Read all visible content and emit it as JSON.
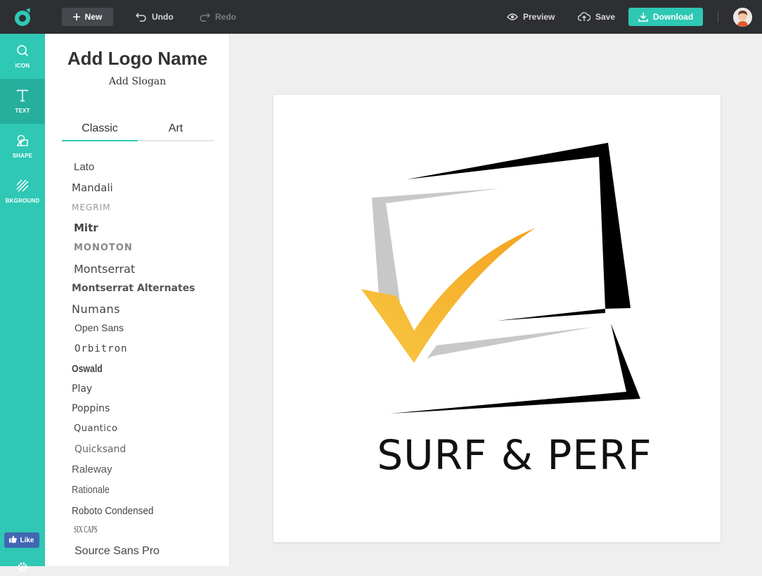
{
  "toolbar": {
    "new_label": "New",
    "undo_label": "Undo",
    "redo_label": "Redo",
    "preview_label": "Preview",
    "save_label": "Save",
    "download_label": "Download"
  },
  "rail": {
    "items": [
      {
        "label": "ICON",
        "icon": "search-icon"
      },
      {
        "label": "TEXT",
        "icon": "text-icon"
      },
      {
        "label": "SHAPE",
        "icon": "shape-icon"
      },
      {
        "label": "BKGROUND",
        "icon": "background-icon"
      }
    ],
    "like_label": "Like"
  },
  "panel": {
    "logo_name": "Add Logo Name",
    "slogan": "Add Slogan",
    "tabs": [
      "Classic",
      "Art"
    ],
    "fonts": [
      "Lato",
      "Mandali",
      "MEGRIM",
      "Mitr",
      "MONOTON",
      "Montserrat",
      "Montserrat Alternates",
      "Numans",
      "Open Sans",
      "Orbitron",
      "Oswald",
      "Play",
      "Poppins",
      "Quantico",
      "Quicksand",
      "Raleway",
      "Rationale",
      "Roboto Condensed",
      "SIX CAPS",
      "Source Sans Pro"
    ]
  },
  "canvas": {
    "brand_text": "SURF & PERF",
    "colors": {
      "accent": "#2ec8b4",
      "check_start": "#f7c43d",
      "check_end": "#f5a623",
      "frame_dark": "#000000",
      "frame_light": "#c8c8c8"
    }
  }
}
